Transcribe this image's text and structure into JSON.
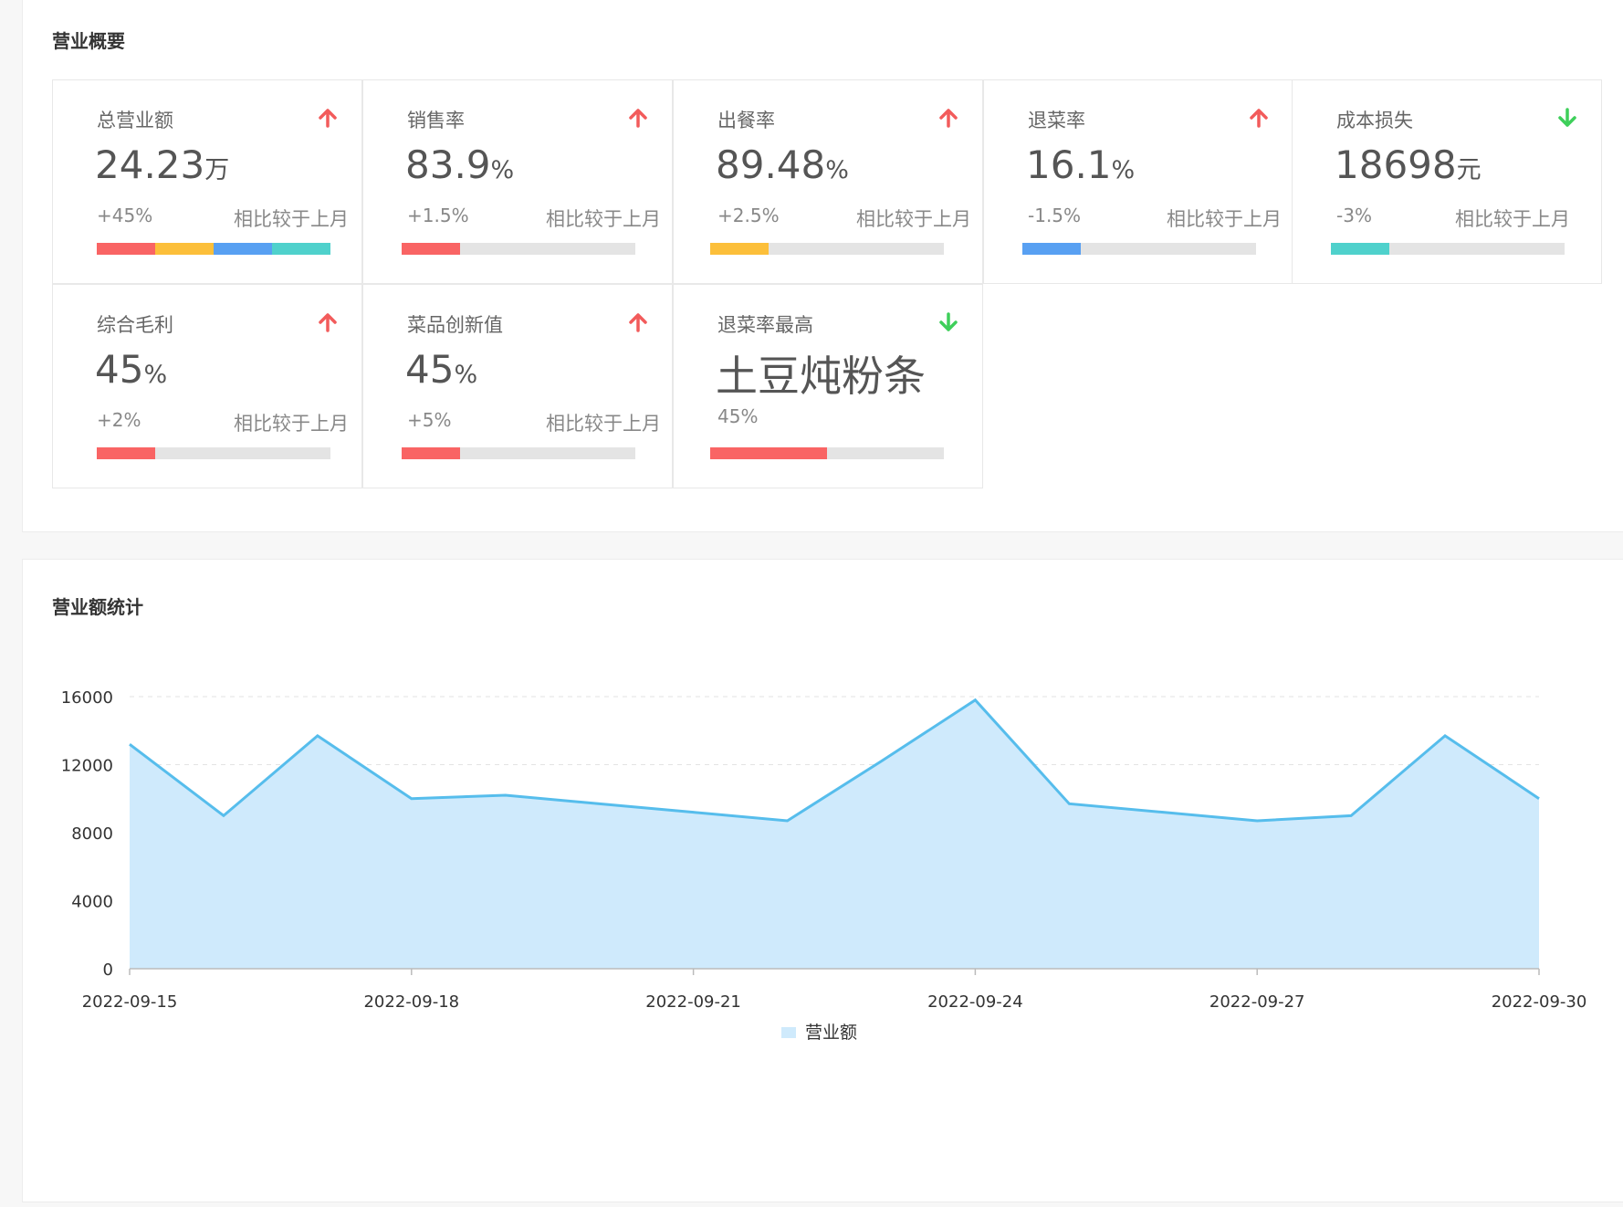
{
  "overview": {
    "title": "营业概要",
    "compare_label": "相比较于上月",
    "cards": [
      {
        "title": "总营业额",
        "value": "24.23",
        "unit": "万",
        "change": "+45%",
        "trend": "up",
        "progress": 1.0,
        "segments": [
          {
            "color": "#f96464",
            "fraction": 0.25
          },
          {
            "color": "#fcbf3a",
            "fraction": 0.25
          },
          {
            "color": "#58a0f2",
            "fraction": 0.25
          },
          {
            "color": "#4fd1cc",
            "fraction": 0.25
          }
        ]
      },
      {
        "title": "销售率",
        "value": "83.9",
        "unit": "%",
        "change": "+1.5%",
        "trend": "up",
        "segments": [
          {
            "color": "#f96464",
            "fraction": 0.25
          }
        ]
      },
      {
        "title": "出餐率",
        "value": "89.48",
        "unit": "%",
        "change": "+2.5%",
        "trend": "up",
        "segments": [
          {
            "color": "#fcbf3a",
            "fraction": 0.25
          }
        ]
      },
      {
        "title": "退菜率",
        "value": "16.1",
        "unit": "%",
        "change": "-1.5%",
        "trend": "up",
        "segments": [
          {
            "color": "#58a0f2",
            "fraction": 0.25
          }
        ]
      },
      {
        "title": "成本损失",
        "value": "18698",
        "unit": "元",
        "change": "-3%",
        "trend": "down",
        "segments": [
          {
            "color": "#4fd1cc",
            "fraction": 0.25
          }
        ]
      },
      {
        "title": "综合毛利",
        "value": "45",
        "unit": "%",
        "change": "+2%",
        "trend": "up",
        "segments": [
          {
            "color": "#f96464",
            "fraction": 0.25
          }
        ]
      },
      {
        "title": "菜品创新值",
        "value": "45",
        "unit": "%",
        "change": "+5%",
        "trend": "up",
        "segments": [
          {
            "color": "#f96464",
            "fraction": 0.25
          }
        ]
      },
      {
        "title": "退菜率最高",
        "value": "土豆炖粉条",
        "unit": "",
        "change": "45%",
        "trend": "down",
        "segments": [
          {
            "color": "#f96464",
            "fraction": 0.5
          }
        ]
      }
    ]
  },
  "colors": {
    "up": "#f25b5b",
    "down": "#3ecf5a",
    "line": "#56bdec",
    "area": "#cfeafc"
  },
  "revenue": {
    "title": "营业额统计",
    "chart_data": {
      "type": "area",
      "x": [
        "2022-09-15",
        "2022-09-16",
        "2022-09-17",
        "2022-09-18",
        "2022-09-19",
        "2022-09-20",
        "2022-09-21",
        "2022-09-22",
        "2022-09-23",
        "2022-09-24",
        "2022-09-25",
        "2022-09-26",
        "2022-09-27",
        "2022-09-28",
        "2022-09-29",
        "2022-09-30"
      ],
      "x_tick_labels": [
        "2022-09-15",
        "2022-09-18",
        "2022-09-21",
        "2022-09-24",
        "2022-09-27",
        "2022-09-30"
      ],
      "series": [
        {
          "name": "营业额",
          "values": [
            13200,
            9000,
            13700,
            10000,
            10200,
            9700,
            9200,
            8700,
            12200,
            15800,
            9700,
            9200,
            8700,
            9000,
            13700,
            10000
          ]
        }
      ],
      "y_ticks": [
        "0",
        "4000",
        "8000",
        "12000",
        "16000"
      ],
      "ylim": [
        0,
        16000
      ],
      "grid": "horizontal dashed",
      "legend_position": "bottom-center"
    }
  }
}
